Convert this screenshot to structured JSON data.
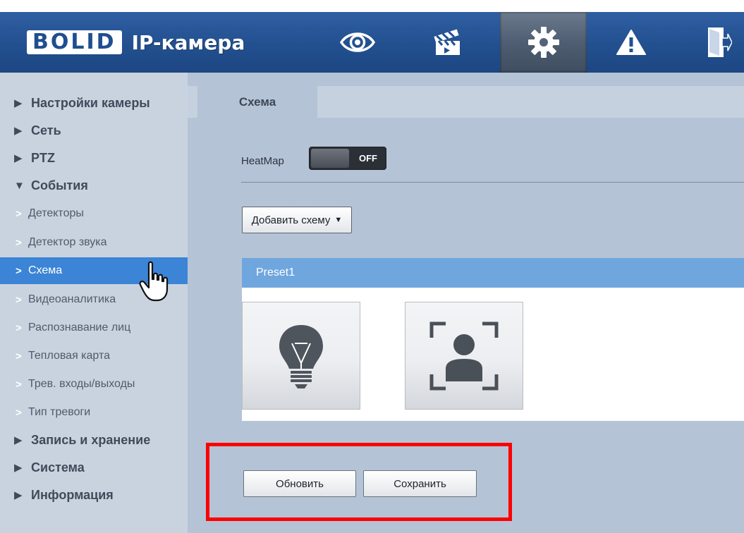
{
  "header": {
    "logo_text": "BOLID",
    "title": "IP-камера",
    "icons": [
      "eye-icon",
      "clapperboard-icon",
      "gear-icon",
      "warning-icon",
      "logout-icon"
    ],
    "active_icon": "gear-icon"
  },
  "sidebar": {
    "items": [
      {
        "label": "Настройки камеры",
        "level": 1,
        "expanded": false
      },
      {
        "label": "Сеть",
        "level": 1,
        "expanded": false
      },
      {
        "label": "PTZ",
        "level": 1,
        "expanded": false
      },
      {
        "label": "События",
        "level": 1,
        "expanded": true
      },
      {
        "label": "Детекторы",
        "level": 2
      },
      {
        "label": "Детектор звука",
        "level": 2
      },
      {
        "label": "Схема",
        "level": 2,
        "selected": true
      },
      {
        "label": "Видеоаналитика",
        "level": 2
      },
      {
        "label": "Распознавание лиц",
        "level": 2
      },
      {
        "label": "Тепловая карта",
        "level": 2
      },
      {
        "label": "Трев. входы/выходы",
        "level": 2
      },
      {
        "label": "Тип тревоги",
        "level": 2
      },
      {
        "label": "Запись и хранение",
        "level": 1,
        "expanded": false
      },
      {
        "label": "Система",
        "level": 1,
        "expanded": false
      },
      {
        "label": "Информация",
        "level": 1,
        "expanded": false
      }
    ]
  },
  "main": {
    "tab_label": "Схема",
    "heatmap": {
      "label": "HeatMap",
      "state": "OFF"
    },
    "add_scheme_label": "Добавить схему",
    "preset": {
      "name": "Preset1",
      "tiles": [
        "lightbulb-icon",
        "face-frame-icon"
      ]
    },
    "refresh_label": "Обновить",
    "save_label": "Сохранить"
  },
  "colors": {
    "header_blue": "#22508f",
    "sidebar_bg": "#c9d3e0",
    "selected_blue": "#3b84d6",
    "content_bg": "#b5c3d6",
    "preset_header": "#6fa6de",
    "highlight_red": "#ff0000"
  }
}
